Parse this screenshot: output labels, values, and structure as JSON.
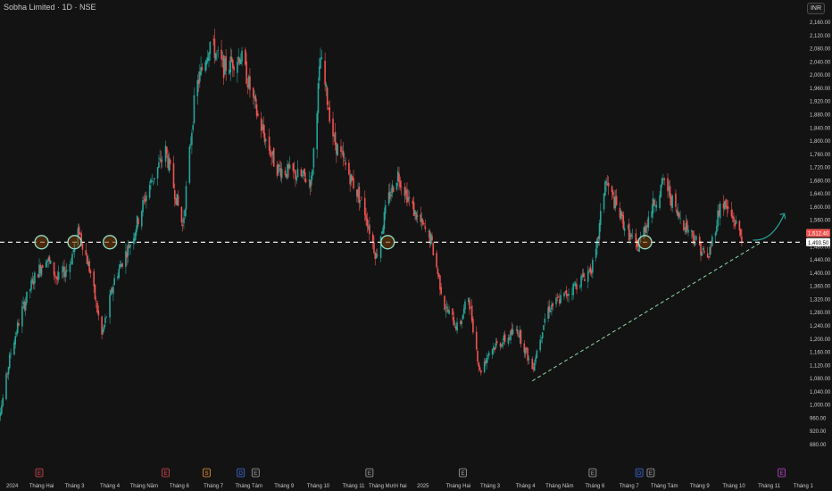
{
  "header": {
    "title": "Sobha Limited · 1D · NSE",
    "currency": "INR"
  },
  "chart_data": {
    "type": "candlestick",
    "ylim": [
      870,
      2200
    ],
    "y_ticks": [
      2160,
      2120,
      2080,
      2040,
      2000,
      1960,
      1920,
      1880,
      1840,
      1800,
      1760,
      1720,
      1680,
      1640,
      1600,
      1560,
      1520,
      1480,
      1440,
      1400,
      1360,
      1320,
      1280,
      1240,
      1200,
      1160,
      1120,
      1080,
      1040,
      1000,
      960,
      920,
      880
    ],
    "y_tick_labels": [
      "2,160.00",
      "2,120.00",
      "2,080.00",
      "2,040.00",
      "2,000.00",
      "1,960.00",
      "1,920.00",
      "1,880.00",
      "1,840.00",
      "1,800.00",
      "1,760.00",
      "1,720.00",
      "1,680.00",
      "1,640.00",
      "1,600.00",
      "1,560.00",
      "1,520.00",
      "1,480.00",
      "1,440.00",
      "1,400.00",
      "1,360.00",
      "1,320.00",
      "1,280.00",
      "1,240.00",
      "1,200.00",
      "1,160.00",
      "1,120.00",
      "1,080.00",
      "1,040.00",
      "1,000.00",
      "960.00",
      "920.00",
      "880.00"
    ],
    "x_tick_labels": [
      "2024",
      "Tháng Hai",
      "Tháng 3",
      "Tháng 4",
      "Tháng Năm",
      "Tháng 6",
      "Tháng 7",
      "Tháng Tám",
      "Tháng 9",
      "Tháng 10",
      "Tháng 11",
      "Tháng Mười hai",
      "2025",
      "Tháng Hai",
      "Tháng 3",
      "Tháng 4",
      "Tháng Năm",
      "Tháng 6",
      "Tháng 7",
      "Tháng Tám",
      "Tháng 9",
      "Tháng 10",
      "Tháng 11",
      "Tháng 1"
    ],
    "x_tick_dates": [
      "2024-01-01",
      "2024-02-01",
      "2024-03-01",
      "2024-04-01",
      "2024-05-01",
      "2024-06-01",
      "2024-07-01",
      "2024-08-01",
      "2024-09-01",
      "2024-10-01",
      "2024-11-01",
      "2024-12-01",
      "2025-01-01",
      "2025-02-01",
      "2025-03-01",
      "2025-04-01",
      "2025-05-01",
      "2025-06-01",
      "2025-07-01",
      "2025-08-01",
      "2025-09-01",
      "2025-10-01",
      "2025-11-01",
      "2025-12-01"
    ],
    "price_path": [
      [
        "2023-12-20",
        920
      ],
      [
        "2023-12-28",
        1000
      ],
      [
        "2024-01-05",
        1160
      ],
      [
        "2024-01-15",
        1290
      ],
      [
        "2024-01-25",
        1380
      ],
      [
        "2024-02-05",
        1450
      ],
      [
        "2024-02-15",
        1380
      ],
      [
        "2024-02-25",
        1420
      ],
      [
        "2024-03-05",
        1530
      ],
      [
        "2024-03-15",
        1400
      ],
      [
        "2024-03-25",
        1210
      ],
      [
        "2024-04-05",
        1380
      ],
      [
        "2024-04-20",
        1500
      ],
      [
        "2024-05-05",
        1660
      ],
      [
        "2024-05-20",
        1770
      ],
      [
        "2024-06-04",
        1540
      ],
      [
        "2024-06-15",
        1950
      ],
      [
        "2024-06-28",
        2100
      ],
      [
        "2024-07-10",
        2020
      ],
      [
        "2024-07-25",
        2060
      ],
      [
        "2024-08-10",
        1860
      ],
      [
        "2024-08-25",
        1720
      ],
      [
        "2024-09-10",
        1700
      ],
      [
        "2024-09-25",
        1680
      ],
      [
        "2024-10-03",
        2050
      ],
      [
        "2024-10-15",
        1800
      ],
      [
        "2024-10-28",
        1700
      ],
      [
        "2024-11-10",
        1600
      ],
      [
        "2024-11-21",
        1450
      ],
      [
        "2024-12-01",
        1620
      ],
      [
        "2024-12-10",
        1700
      ],
      [
        "2024-12-25",
        1580
      ],
      [
        "2025-01-08",
        1500
      ],
      [
        "2025-01-20",
        1300
      ],
      [
        "2025-02-01",
        1230
      ],
      [
        "2025-02-10",
        1330
      ],
      [
        "2025-02-20",
        1100
      ],
      [
        "2025-03-01",
        1170
      ],
      [
        "2025-03-15",
        1200
      ],
      [
        "2025-03-25",
        1230
      ],
      [
        "2025-04-07",
        1110
      ],
      [
        "2025-04-20",
        1290
      ],
      [
        "2025-05-05",
        1330
      ],
      [
        "2025-05-20",
        1380
      ],
      [
        "2025-06-01",
        1430
      ],
      [
        "2025-06-10",
        1680
      ],
      [
        "2025-06-25",
        1560
      ],
      [
        "2025-07-08",
        1470
      ],
      [
        "2025-07-20",
        1590
      ],
      [
        "2025-08-01",
        1680
      ],
      [
        "2025-08-12",
        1580
      ],
      [
        "2025-08-25",
        1520
      ],
      [
        "2025-09-08",
        1440
      ],
      [
        "2025-09-20",
        1620
      ],
      [
        "2025-10-01",
        1560
      ],
      [
        "2025-10-08",
        1512
      ]
    ],
    "current_price_label": "1,512.40",
    "support_price_label": "1,493.50",
    "support_level": 1493.5,
    "trendline": [
      [
        "2025-04-07",
        1073
      ],
      [
        "2025-10-25",
        1493
      ]
    ],
    "touch_points": [
      "2024-02-01",
      "2024-03-01",
      "2024-04-01",
      "2024-12-01",
      "2025-07-15"
    ],
    "projection_arrow": [
      [
        "2025-10-10",
        1500
      ],
      [
        "2025-11-05",
        1580
      ]
    ],
    "event_markers": [
      {
        "date": "2024-01-30",
        "label": "E",
        "color": "#e0424c"
      },
      {
        "date": "2024-05-20",
        "label": "E",
        "color": "#e0424c"
      },
      {
        "date": "2024-06-25",
        "label": "S",
        "color": "#f0912f"
      },
      {
        "date": "2024-07-25",
        "label": "D",
        "color": "#3b6cf0"
      },
      {
        "date": "2024-08-07",
        "label": "E",
        "color": "#a0a0a0"
      },
      {
        "date": "2024-11-15",
        "label": "E",
        "color": "#a0a0a0"
      },
      {
        "date": "2025-02-05",
        "label": "E",
        "color": "#a0a0a0"
      },
      {
        "date": "2025-05-30",
        "label": "E",
        "color": "#a0a0a0"
      },
      {
        "date": "2025-07-10",
        "label": "D",
        "color": "#3b6cf0"
      },
      {
        "date": "2025-07-20",
        "label": "E",
        "color": "#a0a0a0"
      },
      {
        "date": "2025-11-12",
        "label": "E",
        "color": "#c23fd6"
      }
    ],
    "colors": {
      "up": "#26a69a",
      "down": "#ef5350",
      "background": "#131313",
      "support_line": "#ffffff",
      "trendline": "#8fd6a4",
      "circle": "#8fe0c8",
      "current_label_bg": "#ef5350",
      "support_label_bg": "#ffffff"
    }
  }
}
